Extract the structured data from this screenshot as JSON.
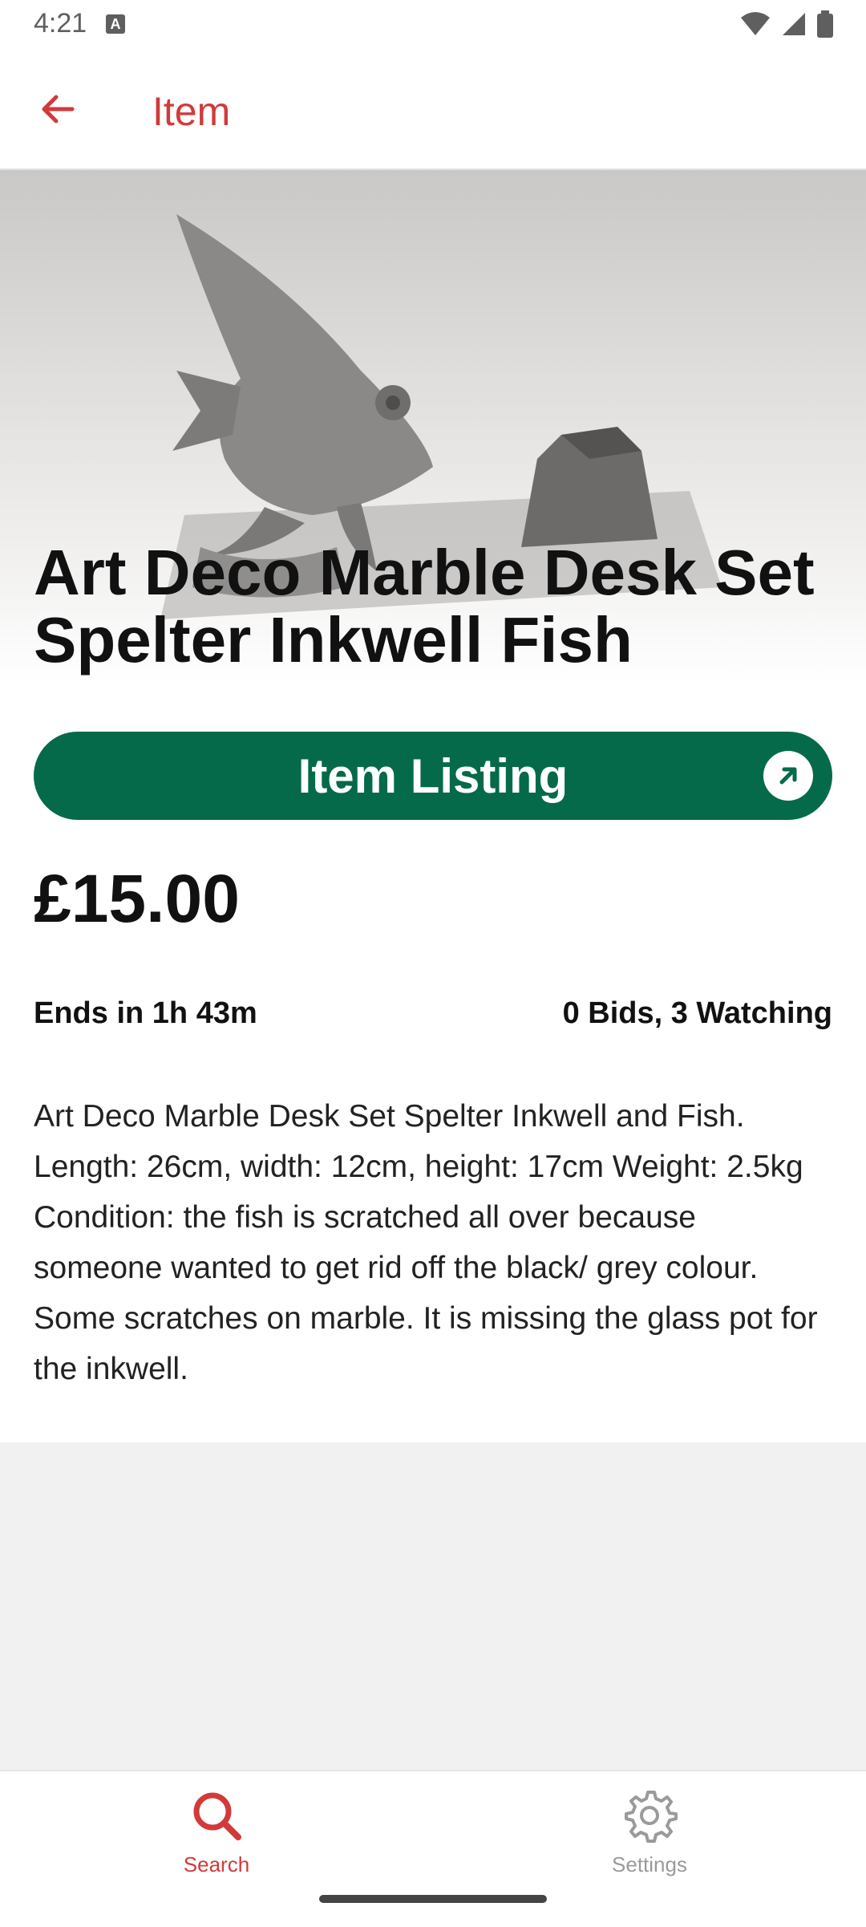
{
  "status_bar": {
    "time": "4:21",
    "notification_glyph": "A"
  },
  "app_bar": {
    "title": "Item",
    "back_icon": "arrow-back-icon",
    "accent": "#d23a3a"
  },
  "item": {
    "title": "Art Deco Marble Desk Set Spelter Inkwell Fish",
    "listing_button_label": "Item Listing",
    "listing_button_color": "#056a4a",
    "price": "£15.00",
    "ends": "Ends in 1h 43m",
    "bids_watching": "0 Bids, 3 Watching",
    "description": "Art Deco Marble Desk Set Spelter Inkwell and Fish. Length: 26cm, width: 12cm, height: 17cm Weight: 2.5kg Condition: the fish is scratched all over because someone wanted to get rid off the black/ grey colour. Some scratches on marble. It is missing the glass pot for the inkwell."
  },
  "bottom_nav": {
    "items": [
      {
        "label": "Search",
        "icon": "search-icon",
        "active": true,
        "color": "#d23a3a"
      },
      {
        "label": "Settings",
        "icon": "gear-icon",
        "active": false,
        "color": "#9a9a9a"
      }
    ]
  }
}
